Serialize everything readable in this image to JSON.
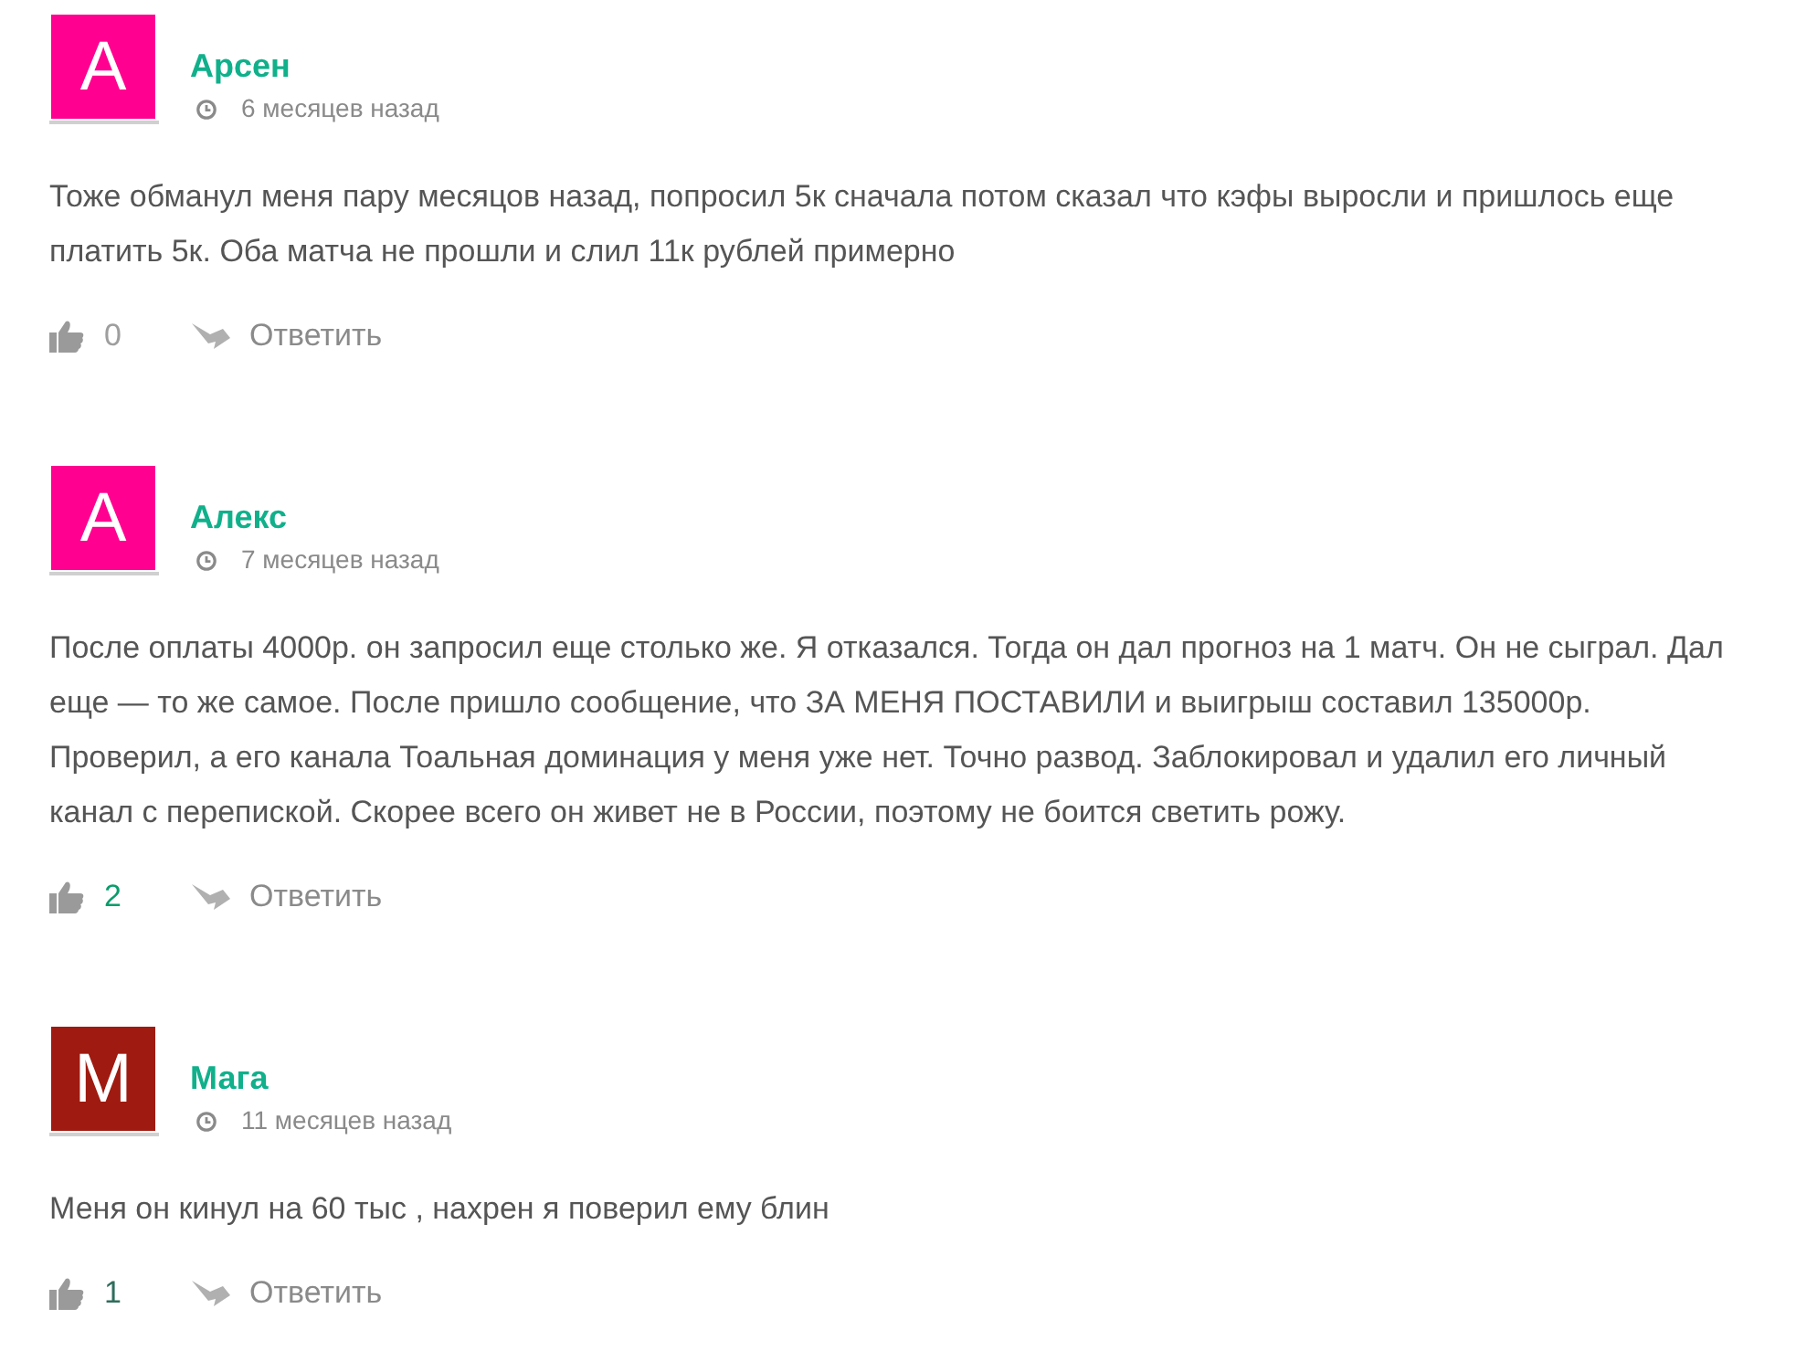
{
  "comments": [
    {
      "avatar_letter": "A",
      "color": "#ff0090",
      "author": "Арсен",
      "time": "6 месяцев назад",
      "text": "Тоже обманул меня пару месяцов назад, попросил 5к сначала потом сказал что кэфы выросли и пришлось еще платить 5к. Оба матча не прошли и слил 11к рублей примерно",
      "likes": {
        "count": "0",
        "color": "#9e9e9e"
      },
      "reply": "Ответить"
    },
    {
      "avatar_letter": "A",
      "color": "#ff0090",
      "author": "Алекс",
      "time": "7 месяцев назад",
      "text": "После оплаты 4000р. он запросил еще столько же. Я отказался. Тогда он дал прогноз на 1 матч. Он не сыграл. Дал еще — то же самое. После пришло сообщение, что ЗА МЕНЯ ПОСТАВИЛИ и выигрыш составил 135000р. Проверил, а его канала Тоальная доминация у меня уже нет. Точно развод. Заблокировал и удалил его личный канал с перепиской. Скорее всего он живет не в России, поэтому не боится светить рожу.",
      "likes": {
        "count": "2",
        "color": "#0a9d6b"
      },
      "reply": "Ответить"
    },
    {
      "avatar_letter": "M",
      "color": "#9f1a10",
      "author": "Мага",
      "time": "11 месяцев назад",
      "text": "Меня он кинул на 60 тыс , нахрен я поверил ему блин",
      "likes": {
        "count": "1",
        "color": "#2f6d5c"
      },
      "reply": "Ответить"
    }
  ]
}
